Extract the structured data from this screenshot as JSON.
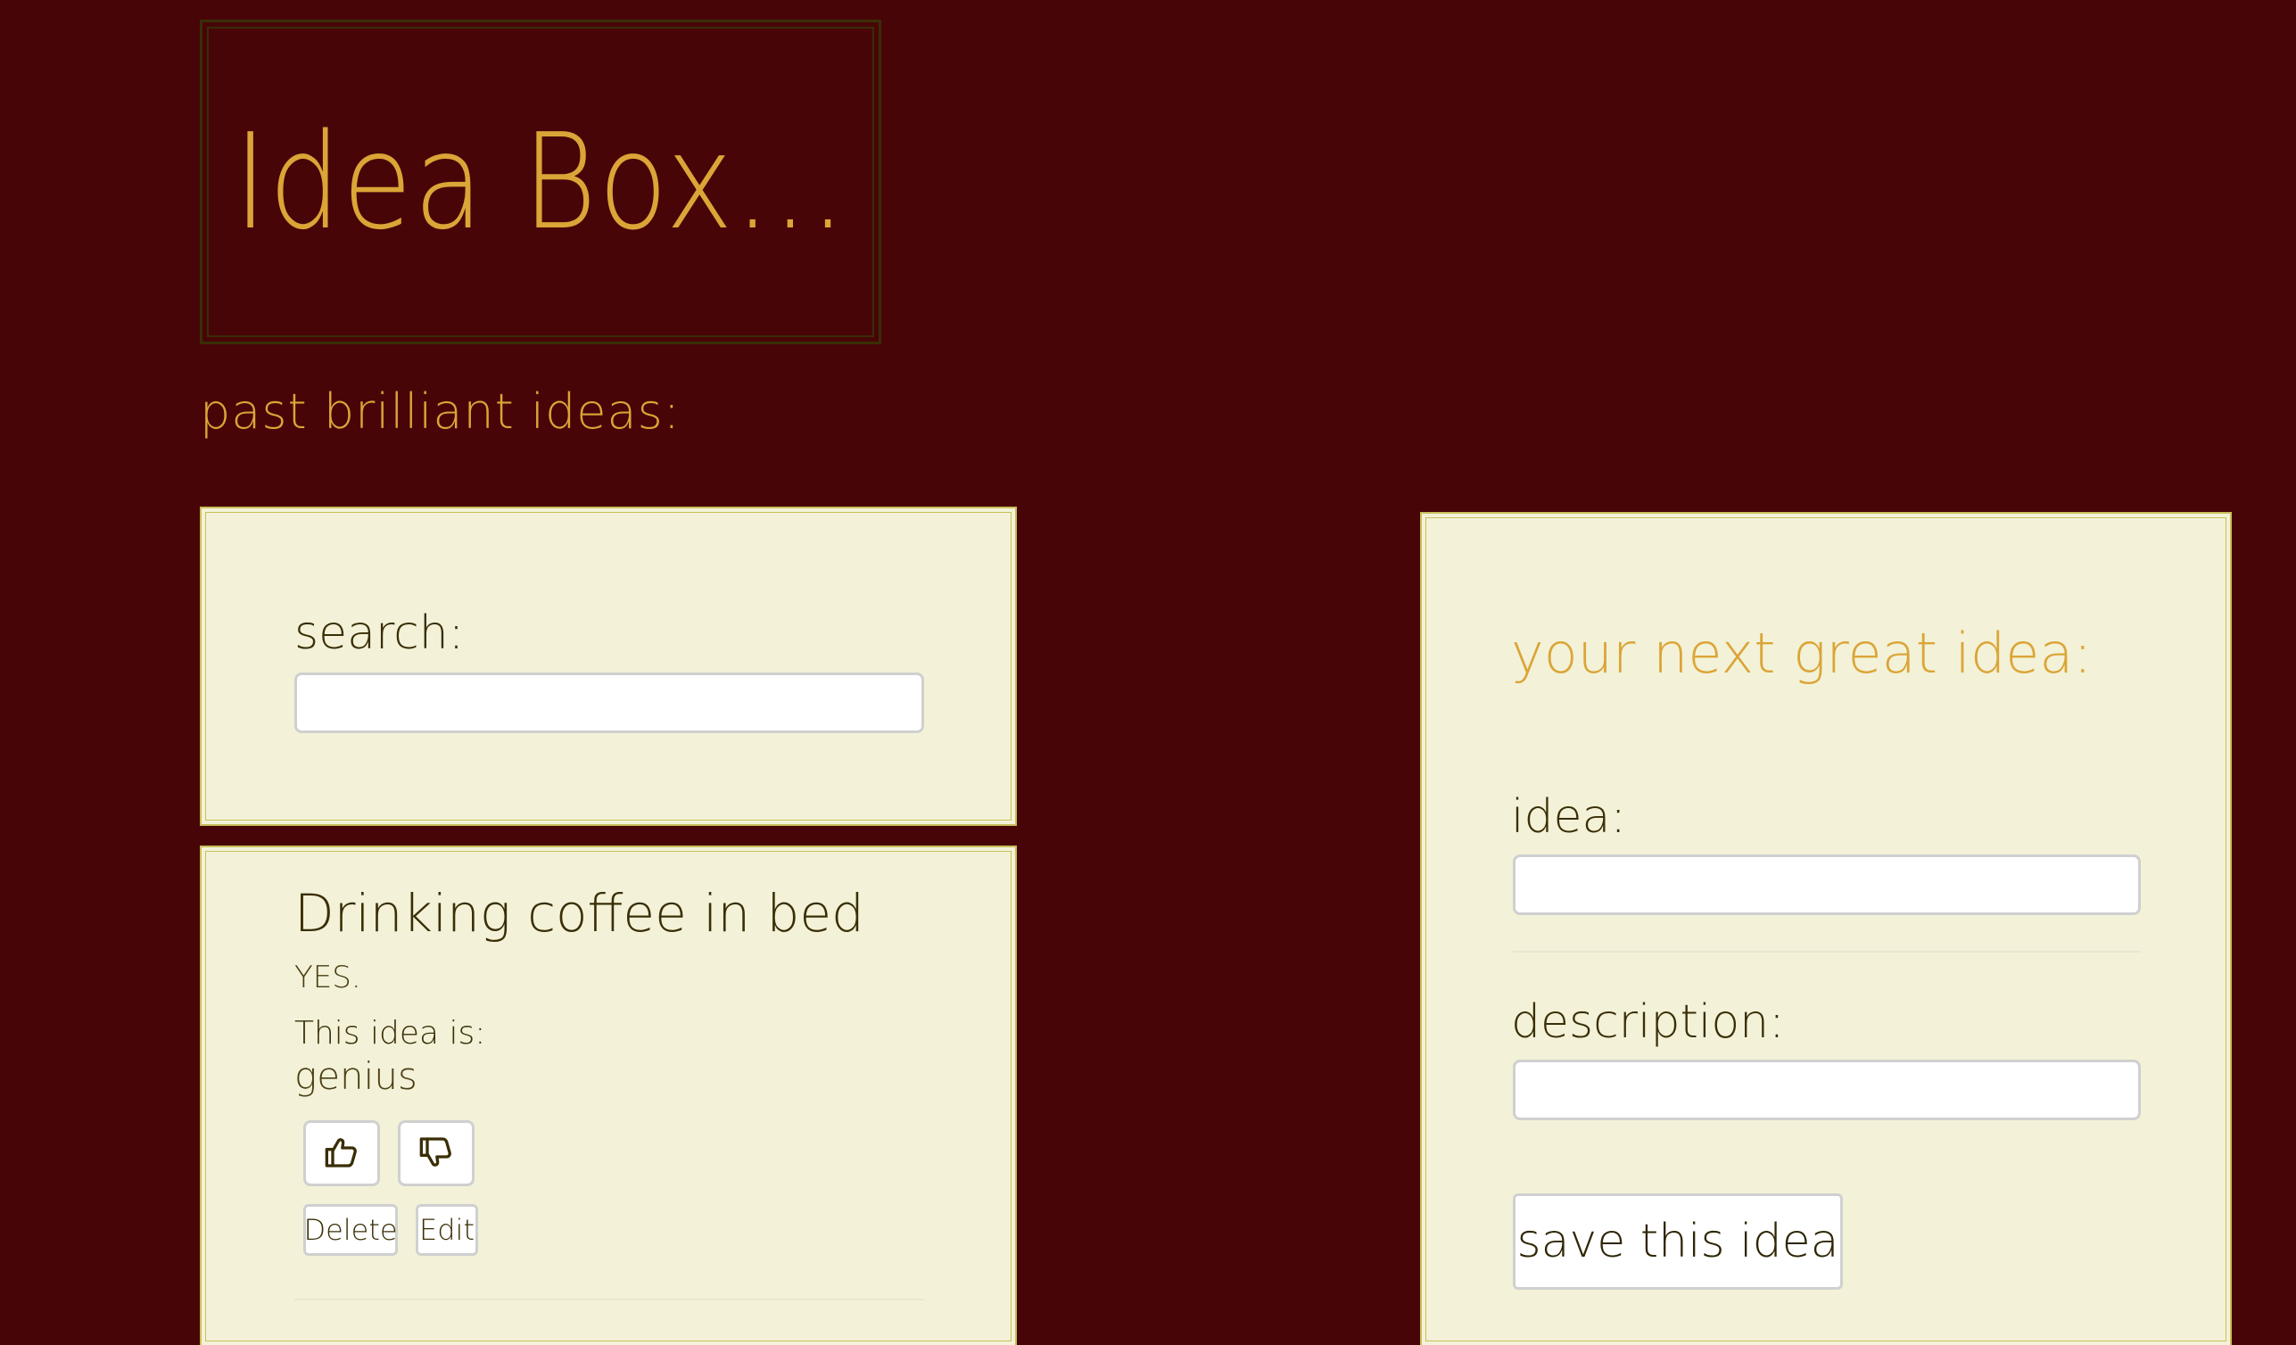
{
  "header": {
    "title": "Idea Box..."
  },
  "ideas_section": {
    "heading": "past brilliant ideas:"
  },
  "search": {
    "label": "search:",
    "value": ""
  },
  "ideas": [
    {
      "title": "Drinking coffee in bed",
      "description": "YES.",
      "quality_label": "This idea is:",
      "quality": "genius",
      "upvote_icon": "thumbs-up-icon",
      "downvote_icon": "thumbs-down-icon",
      "delete_label": "Delete",
      "edit_label": "Edit"
    }
  ],
  "form": {
    "heading": "your next great idea:",
    "idea_label": "idea:",
    "idea_value": "",
    "description_label": "description:",
    "description_value": "",
    "save_label": "save this idea"
  }
}
